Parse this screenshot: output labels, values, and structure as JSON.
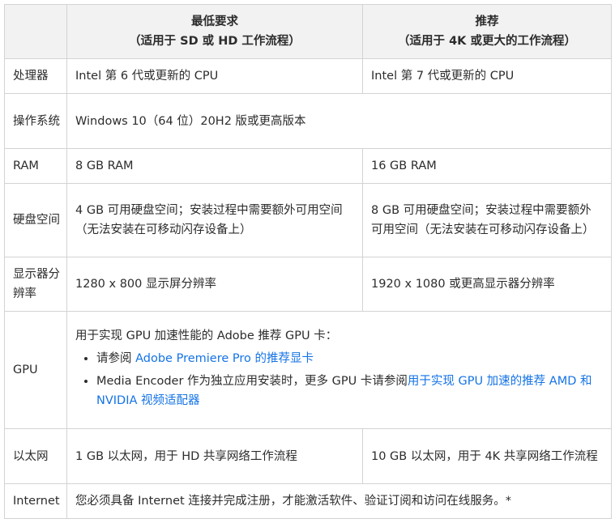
{
  "header": {
    "col1": "",
    "col2_line1": "最低要求",
    "col2_line2": "（适用于 SD 或 HD 工作流程）",
    "col3_line1": "推荐",
    "col3_line2": "（适用于 4K 或更大的工作流程）"
  },
  "rows": {
    "cpu": {
      "label": "处理器",
      "min": "Intel 第 6 代或更新的 CPU",
      "rec": "Intel 第 7 代或更新的 CPU"
    },
    "os": {
      "label": "操作系统",
      "value": "Windows 10（64 位）20H2 版或更高版本"
    },
    "ram": {
      "label": "RAM",
      "min": "8 GB RAM",
      "rec": "16 GB RAM"
    },
    "disk": {
      "label": "硬盘空间",
      "min": "4 GB 可用硬盘空间；安装过程中需要额外可用空间（无法安装在可移动闪存设备上）",
      "rec": "8 GB 可用硬盘空间；安装过程中需要额外可用空间（无法安装在可移动闪存设备上）"
    },
    "display": {
      "label": "显示器分辨率",
      "min": "1280 x 800 显示屏分辨率",
      "rec": "1920 x 1080 或更高显示器分辨率"
    },
    "gpu": {
      "label": "GPU",
      "intro": "用于实现 GPU 加速性能的 Adobe 推荐 GPU 卡：",
      "item1_prefix": "请参阅 ",
      "item1_link": "Adobe Premiere Pro 的推荐显卡",
      "item2_prefix": "Media Encoder 作为独立应用安装时，更多 GPU 卡请参阅",
      "item2_link": "用于实现 GPU 加速的推荐 AMD 和 NVIDIA 视频适配器"
    },
    "ethernet": {
      "label": "以太网",
      "min": "1 GB 以太网，用于 HD 共享网络工作流程",
      "rec": "10 GB 以太网，用于 4K 共享网络工作流程"
    },
    "internet": {
      "label": "Internet",
      "value": "您必须具备 Internet 连接并完成注册，才能激活软件、验证订阅和访问在线服务。*"
    }
  },
  "colors": {
    "border": "#d3d3d3",
    "header_bg": "#f2f2f2",
    "link": "#1473e6",
    "text": "#2c2c2c"
  }
}
